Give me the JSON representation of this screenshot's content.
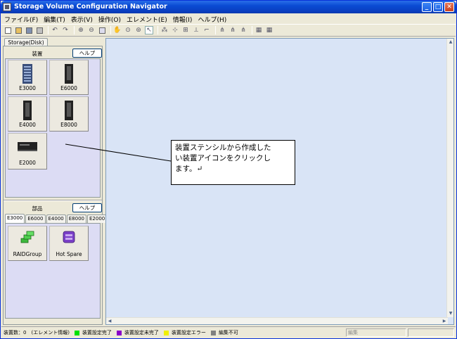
{
  "window": {
    "title": "Storage Volume Configuration Navigator",
    "min_symbol": "_",
    "max_symbol": "□",
    "close_symbol": "✕"
  },
  "menu": [
    "ファイル(F)",
    "編集(T)",
    "表示(V)",
    "操作(O)",
    "エレメント(E)",
    "情報(I)",
    "ヘルプ(H)"
  ],
  "toolbar": {
    "icons": [
      "new-icon",
      "open-icon",
      "save-icon",
      "print-icon",
      "undo-icon",
      "redo-icon",
      "zoom-in-icon",
      "zoom-out-icon",
      "fit-icon",
      "pan-icon",
      "zoom-area-icon",
      "zoom-select-icon",
      "select-arrow-icon",
      "layout-1-icon",
      "layout-2-icon",
      "layout-3-icon",
      "layout-4-icon",
      "layout-5-icon",
      "tree-1-icon",
      "tree-2-icon",
      "tree-3-icon",
      "grid-1-icon",
      "grid-2-icon"
    ]
  },
  "left_panel": {
    "tab_label": "Storage(Disk)",
    "devices_section": {
      "title": "装置",
      "help_label": "ヘルプ",
      "devices": [
        {
          "label": "E3000",
          "icon": "rack-storage-icon"
        },
        {
          "label": "E6000",
          "icon": "tower-storage-icon"
        },
        {
          "label": "E4000",
          "icon": "tower-storage-icon"
        },
        {
          "label": "E8000",
          "icon": "tower-storage-icon"
        },
        {
          "label": "E2000",
          "icon": "desktop-storage-icon"
        }
      ]
    },
    "parts_section": {
      "title": "部品",
      "help_label": "ヘルプ",
      "tabs": [
        "E3000",
        "E6000",
        "E4000",
        "E8000",
        "E2000"
      ],
      "active_tab": "E3000",
      "parts": [
        {
          "label": "RAIDGroup",
          "icon": "raid-group-icon"
        },
        {
          "label": "Hot Spare",
          "icon": "hot-spare-icon"
        }
      ]
    }
  },
  "canvas": {
    "callout_lines": [
      "装置ステンシルから作成した",
      "い装置アイコンをクリックし",
      "ます。↵"
    ]
  },
  "statusbar": {
    "count_label": "装置数：0",
    "info_label": "(エレメント情報)",
    "legend": [
      {
        "label": "装置設定完了",
        "color": "#00e000"
      },
      {
        "label": "装置設定未完了",
        "color": "#8a00c8"
      },
      {
        "label": "装置設定エラー",
        "color": "#f0f000"
      },
      {
        "label": "編集不可",
        "color": "#808080"
      }
    ],
    "mode_label": "編集"
  }
}
